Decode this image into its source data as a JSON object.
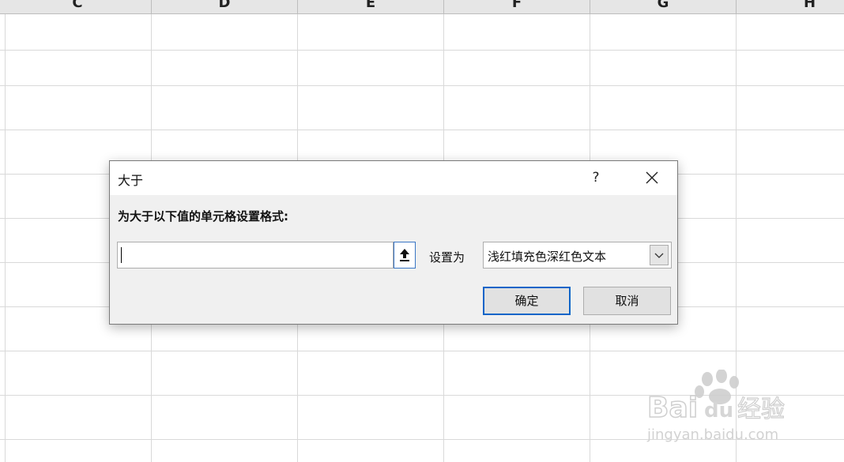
{
  "sheet": {
    "columns": [
      "C",
      "D",
      "E",
      "F",
      "G",
      "H"
    ]
  },
  "dialog": {
    "title": "大于",
    "help_label": "?",
    "prompt": "为大于以下值的单元格设置格式:",
    "value_input": "",
    "set_label": "设置为",
    "format_selected": "浅红填充色深红色文本",
    "ok_label": "确定",
    "cancel_label": "取消"
  },
  "watermark": {
    "brand": "Bai",
    "brand2": "du",
    "product": "经验",
    "url": "jingyan.baidu.com"
  },
  "colors": {
    "accent": "#0a64c8",
    "grid": "#d9d9d9",
    "dialog_bg": "#f0f0f0"
  }
}
